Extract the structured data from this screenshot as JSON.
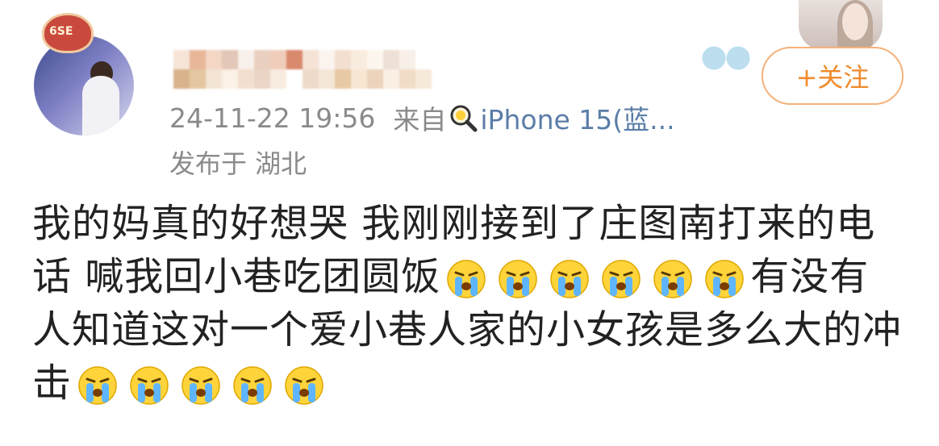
{
  "post": {
    "timestamp": "24-11-22 19:56",
    "source_prefix": "来自",
    "source_device": "iPhone 15(蓝...",
    "location": "发布于 湖北",
    "avatar_badge_text": "6SE"
  },
  "follow_button": {
    "label": "+关注"
  },
  "content": {
    "line1": "我的妈真的好想哭 我刚刚接到了庄图南打来的电",
    "line2_text": "话 喊我回小巷吃团圆饭",
    "line2_tail": "有没有",
    "line3": "人知道这对一个爱小巷人家的小女孩是多么大的冲",
    "line4": "击",
    "emoji_name": "crying-face"
  },
  "colors": {
    "accent": "#f08a2c",
    "meta_gray": "#8a8a8a",
    "link_blue": "#5b7da8",
    "text": "#222222"
  }
}
